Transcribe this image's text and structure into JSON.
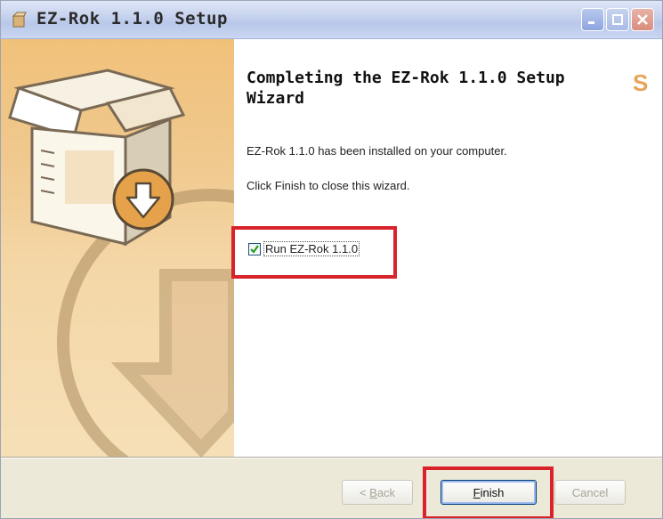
{
  "window": {
    "title": "EZ-Rok 1.1.0 Setup"
  },
  "content": {
    "heading_line1": "Completing the EZ-Rok 1.1.0 Setup",
    "heading_line2": "Wizard",
    "installed_text": "EZ-Rok 1.1.0 has been installed on your computer.",
    "finish_hint": "Click Finish to close this wizard.",
    "run_checkbox": {
      "label": "Run EZ-Rok 1.1.0",
      "checked": true
    }
  },
  "buttons": {
    "back_prefix": "< ",
    "back_accel": "B",
    "back_rest": "ack",
    "finish_accel": "F",
    "finish_rest": "inish",
    "cancel": "Cancel"
  },
  "colors": {
    "highlight": "#d9232b",
    "banner": "#f0c98f",
    "window_bg": "#ece9d8"
  },
  "icons": {
    "title": "installer-box-icon",
    "banner": "package-download-icon"
  }
}
